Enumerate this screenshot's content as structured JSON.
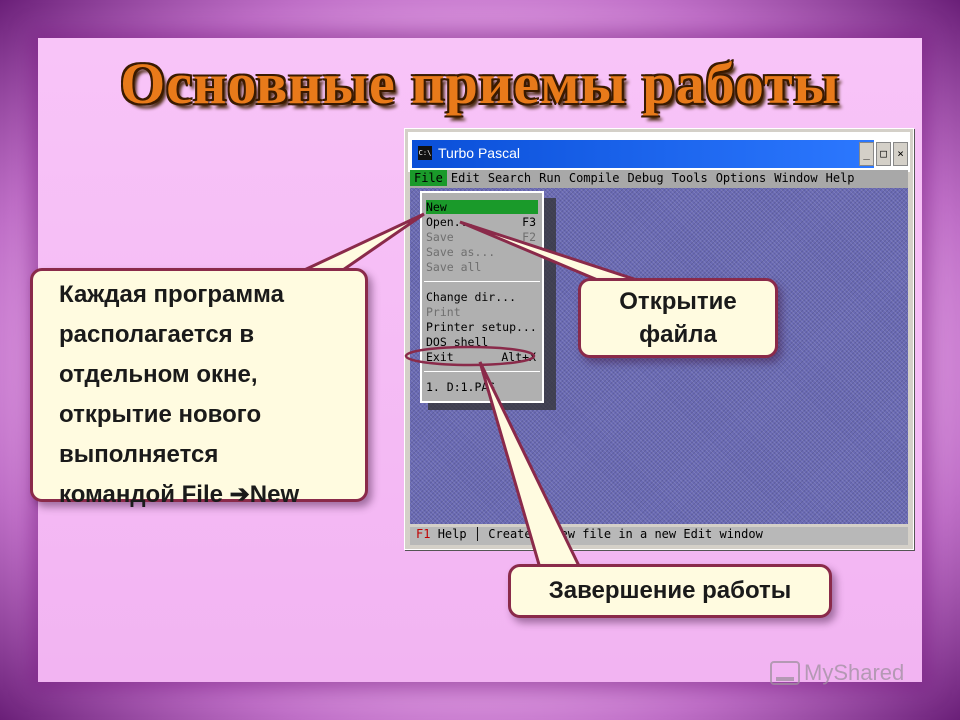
{
  "slide": {
    "title": "Основные приемы работы",
    "watermark": "MyShared"
  },
  "window": {
    "title": "Turbo Pascal",
    "icon_text": "C:\\",
    "controls": [
      "_",
      "□",
      "×"
    ],
    "menu": [
      "File",
      "Edit",
      "Search",
      "Run",
      "Compile",
      "Debug",
      "Tools",
      "Options",
      "Window",
      "Help"
    ],
    "active_menu": "File",
    "dropdown": [
      {
        "label": "New",
        "shortcut": "",
        "state": "selected"
      },
      {
        "label": "Open...",
        "shortcut": "F3",
        "state": "enabled"
      },
      {
        "label": "Save",
        "shortcut": "F2",
        "state": "disabled"
      },
      {
        "label": "Save as...",
        "shortcut": "",
        "state": "disabled"
      },
      {
        "label": "Save all",
        "shortcut": "",
        "state": "disabled"
      },
      {
        "label": "Change dir...",
        "shortcut": "",
        "state": "enabled"
      },
      {
        "label": "Print",
        "shortcut": "",
        "state": "disabled"
      },
      {
        "label": "Printer setup...",
        "shortcut": "",
        "state": "enabled"
      },
      {
        "label": "DOS shell",
        "shortcut": "",
        "state": "enabled"
      },
      {
        "label": "Exit",
        "shortcut": "Alt+X",
        "state": "enabled"
      },
      {
        "label": "1. D:1.PAS",
        "shortcut": "",
        "state": "enabled"
      }
    ],
    "status": {
      "key": "F1",
      "key_label": "Help",
      "message": "Create a new file in a new Edit window"
    }
  },
  "callouts": {
    "new_window": [
      "Каждая программа",
      "располагается в",
      "отдельном окне,",
      "открытие нового",
      "выполняется",
      "командой File ➔New"
    ],
    "open_file": [
      "Открытие",
      "файла"
    ],
    "exit": "Завершение работы"
  },
  "colors": {
    "callout_border": "#8a2a4a",
    "title_orange": "#e87a1a",
    "menu_highlight": "#1a9a2a",
    "arrow_line": "#8a2a4a"
  }
}
